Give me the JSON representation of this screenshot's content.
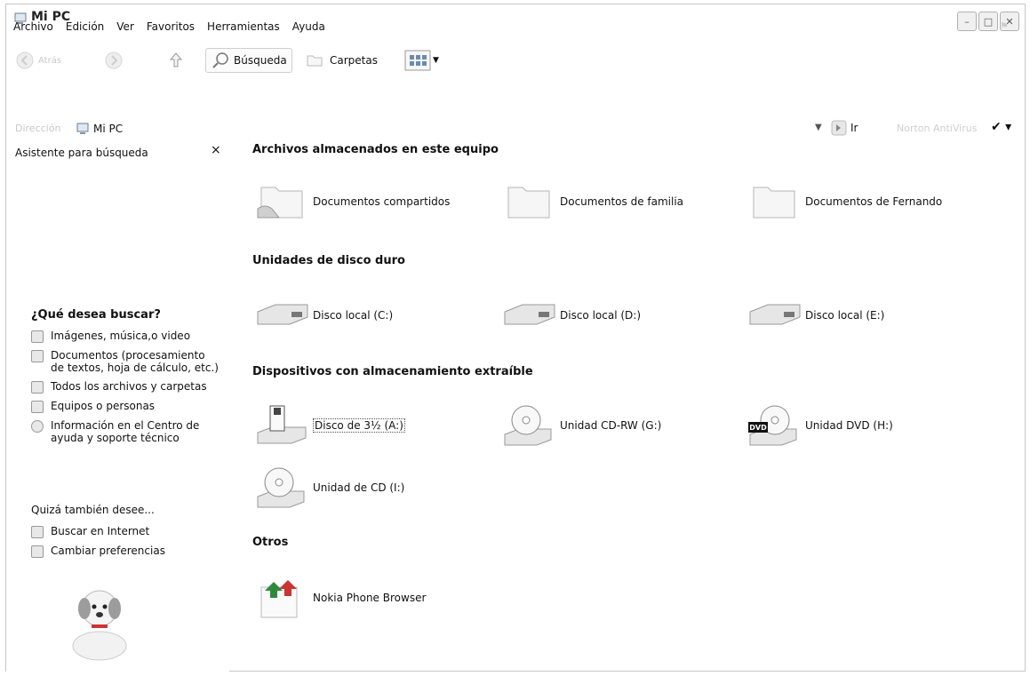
{
  "window": {
    "title": "Mi PC"
  },
  "menu": [
    "Archivo",
    "Edición",
    "Ver",
    "Favoritos",
    "Herramientas",
    "Ayuda"
  ],
  "toolbar": {
    "back": "Atrás",
    "search": "Búsqueda",
    "folders": "Carpetas"
  },
  "address": {
    "label": "Dirección",
    "value": "Mi PC",
    "go": "Ir",
    "norton": "Norton AntiVirus"
  },
  "left": {
    "header": "Asistente para búsqueda",
    "close": "×",
    "title": "¿Qué desea buscar?",
    "items": [
      "Imágenes, música,o video",
      "Documentos (procesamiento de textos, hoja de cálculo, etc.)",
      "Todos los archivos y carpetas",
      "Equipos o personas",
      "Información en el Centro de ayuda y soporte técnico"
    ],
    "also": "Quizá también desee...",
    "also_items": [
      "Buscar en Internet",
      "Cambiar preferencias"
    ]
  },
  "sections": {
    "stored": "Archivos almacenados en este equipo",
    "hdd": "Unidades de disco duro",
    "removable": "Dispositivos con almacenamiento extraíble",
    "other": "Otros"
  },
  "folders": [
    "Documentos compartidos",
    "Documentos de familia",
    "Documentos de Fernando"
  ],
  "disks": [
    "Disco local (C:)",
    "Disco local (D:)",
    "Disco local (E:)"
  ],
  "removable": [
    "Disco de 3½ (A:)",
    "Unidad CD-RW (G:)",
    "Unidad DVD (H:)",
    "Unidad de CD (I:)"
  ],
  "dvd_badge": "DVD",
  "other": [
    "Nokia Phone Browser"
  ]
}
